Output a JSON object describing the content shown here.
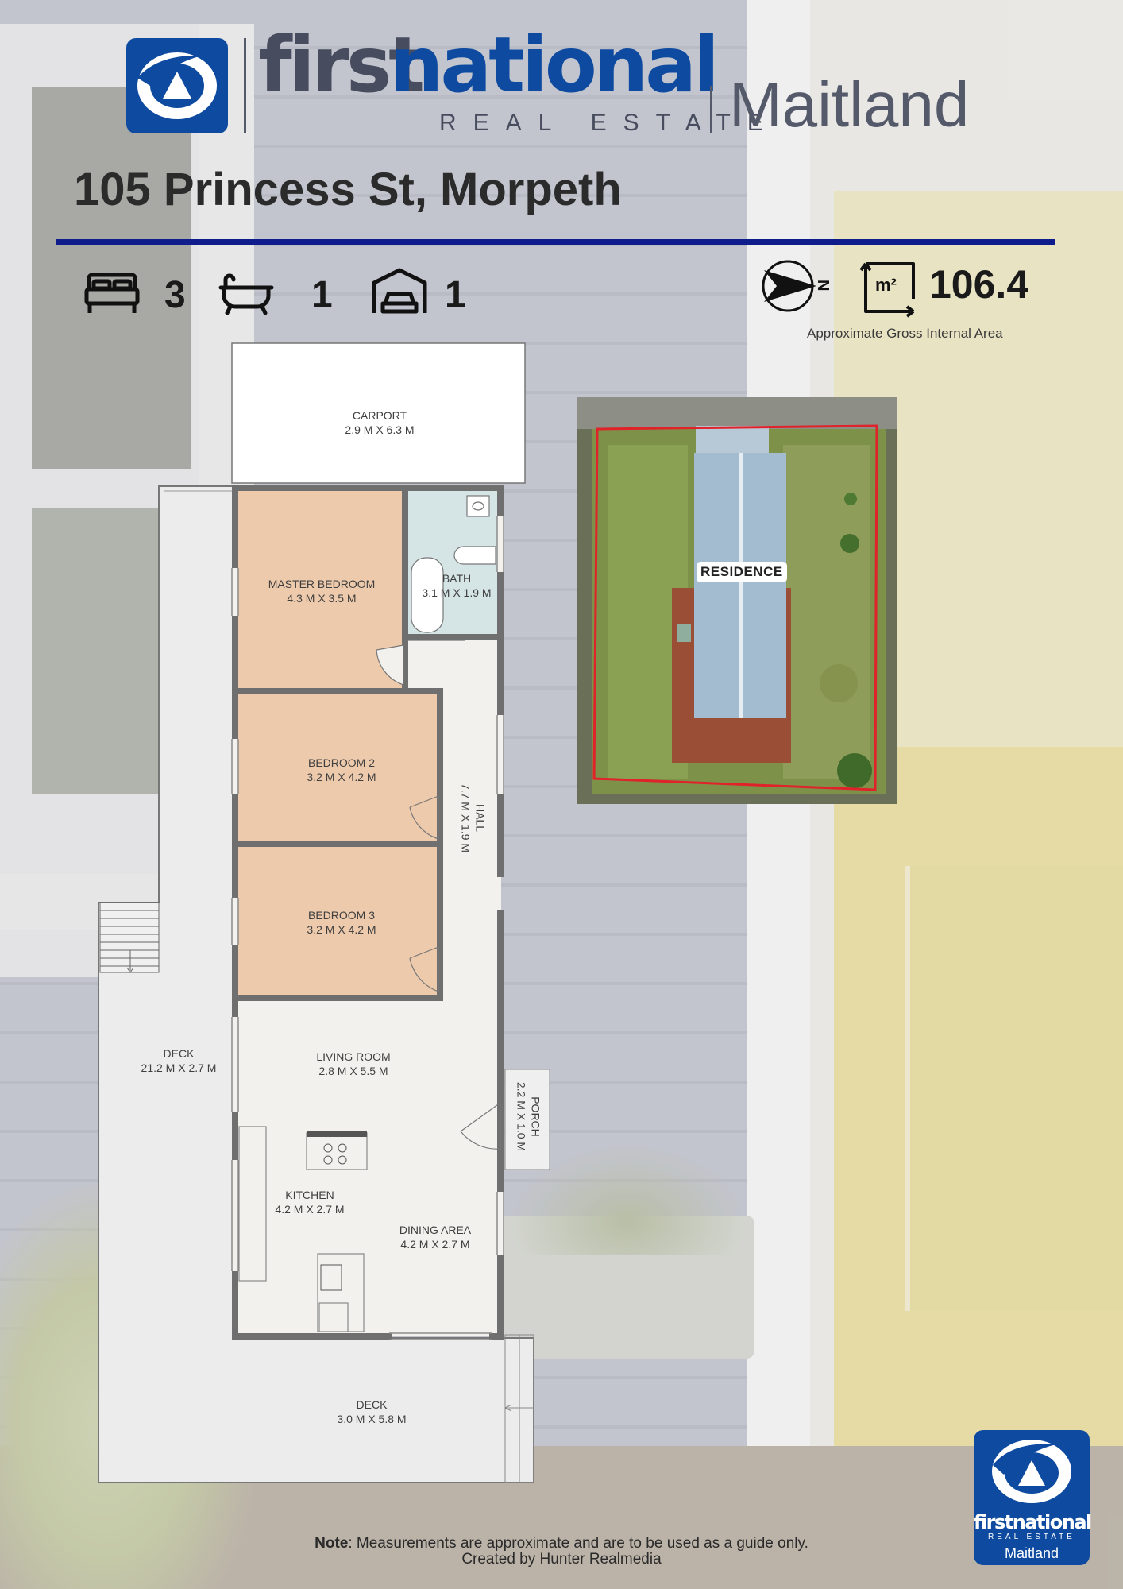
{
  "brand": {
    "first": "first",
    "national": "national",
    "real_estate": "REAL ESTATE",
    "office": "Maitland"
  },
  "property": {
    "address": "105 Princess St, Morpeth",
    "bedrooms": "3",
    "bathrooms": "1",
    "car_spaces": "1",
    "area_value": "106.4",
    "area_unit": "m²",
    "area_caption": "Approximate Gross Internal Area"
  },
  "rooms": {
    "carport": {
      "name": "CARPORT",
      "dims": "2.9 M X 6.3 M"
    },
    "master_bedroom": {
      "name": "MASTER BEDROOM",
      "dims": "4.3 M X 3.5 M"
    },
    "bath": {
      "name": "BATH",
      "dims": "3.1 M X 1.9 M"
    },
    "bedroom2": {
      "name": "BEDROOM 2",
      "dims": "3.2 M X 4.2 M"
    },
    "hall": {
      "name": "HALL",
      "dims": "7.7 M X 1.9 M"
    },
    "bedroom3": {
      "name": "BEDROOM 3",
      "dims": "3.2 M X 4.2 M"
    },
    "side_deck": {
      "name": "DECK",
      "dims": "21.2 M X 2.7 M"
    },
    "living_room": {
      "name": "LIVING ROOM",
      "dims": "2.8 M X 5.5 M"
    },
    "porch": {
      "name": "PORCH",
      "dims": "2.2 M X 1.0 M"
    },
    "kitchen": {
      "name": "KITCHEN",
      "dims": "4.2 M X 2.7 M"
    },
    "dining": {
      "name": "DINING AREA",
      "dims": "4.2 M X 2.7 M"
    },
    "rear_deck": {
      "name": "DECK",
      "dims": "3.0 M X 5.8 M"
    }
  },
  "aerial": {
    "label": "RESIDENCE"
  },
  "footer": {
    "note_label": "Note",
    "note_text": ": Measurements are approximate and are to be used as a guide only.",
    "credit": "Created by Hunter Realmedia"
  },
  "colors": {
    "brand_blue": "#0e4ba0",
    "brand_grey": "#474c5e",
    "rule_blue": "#0f1d8c",
    "bedroom_fill": "#eecaac",
    "bath_fill": "#d5e5e6",
    "boundary_red": "#e0222a"
  },
  "icons": [
    "bed-icon",
    "bathtub-icon",
    "garage-icon",
    "north-arrow-icon",
    "area-icon"
  ]
}
